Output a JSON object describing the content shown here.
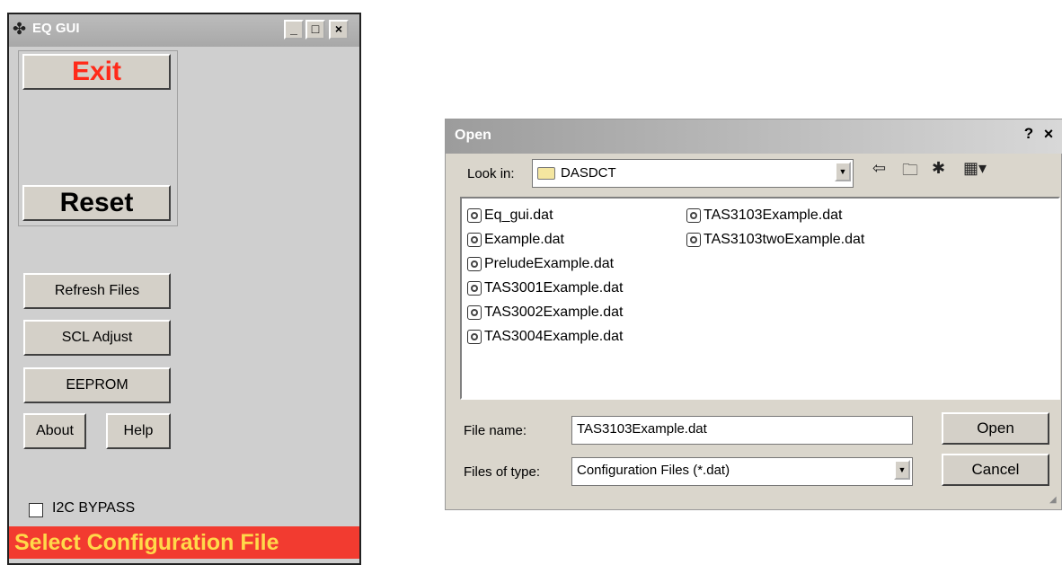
{
  "eq_gui": {
    "title": "EQ GUI",
    "title_buttons": {
      "minimize": "_",
      "maximize": "□",
      "close": "×"
    },
    "buttons": {
      "exit": "Exit",
      "reset": "Reset",
      "refresh_files": "Refresh Files",
      "scl_adjust": "SCL Adjust",
      "eeprom": "EEPROM",
      "about": "About",
      "help": "Help"
    },
    "i2c_bypass_label": "I2C BYPASS",
    "status_text": "Select Configuration File",
    "colors": {
      "exit_text": "#ff2a1a",
      "status_bg": "#f23b30",
      "status_text": "#ffd94a"
    }
  },
  "open_dialog": {
    "title": "Open",
    "title_buttons": {
      "help": "?",
      "close": "×"
    },
    "look_in_label": "Look in:",
    "look_in_value": "DASDCT",
    "files": [
      "Eq_gui.dat",
      "Example.dat",
      "PreludeExample.dat",
      "TAS3001Example.dat",
      "TAS3002Example.dat",
      "TAS3004Example.dat",
      "TAS3103Example.dat",
      "TAS3103twoExample.dat"
    ],
    "file_name_label": "File name:",
    "file_name_value": "TAS3103Example.dat",
    "files_of_type_label": "Files of type:",
    "files_of_type_value": "Configuration Files (*.dat)",
    "open_button": "Open",
    "cancel_button": "Cancel",
    "toolbar_icons": [
      "back-arrow-icon",
      "up-folder-icon",
      "new-folder-icon",
      "view-menu-icon"
    ]
  }
}
